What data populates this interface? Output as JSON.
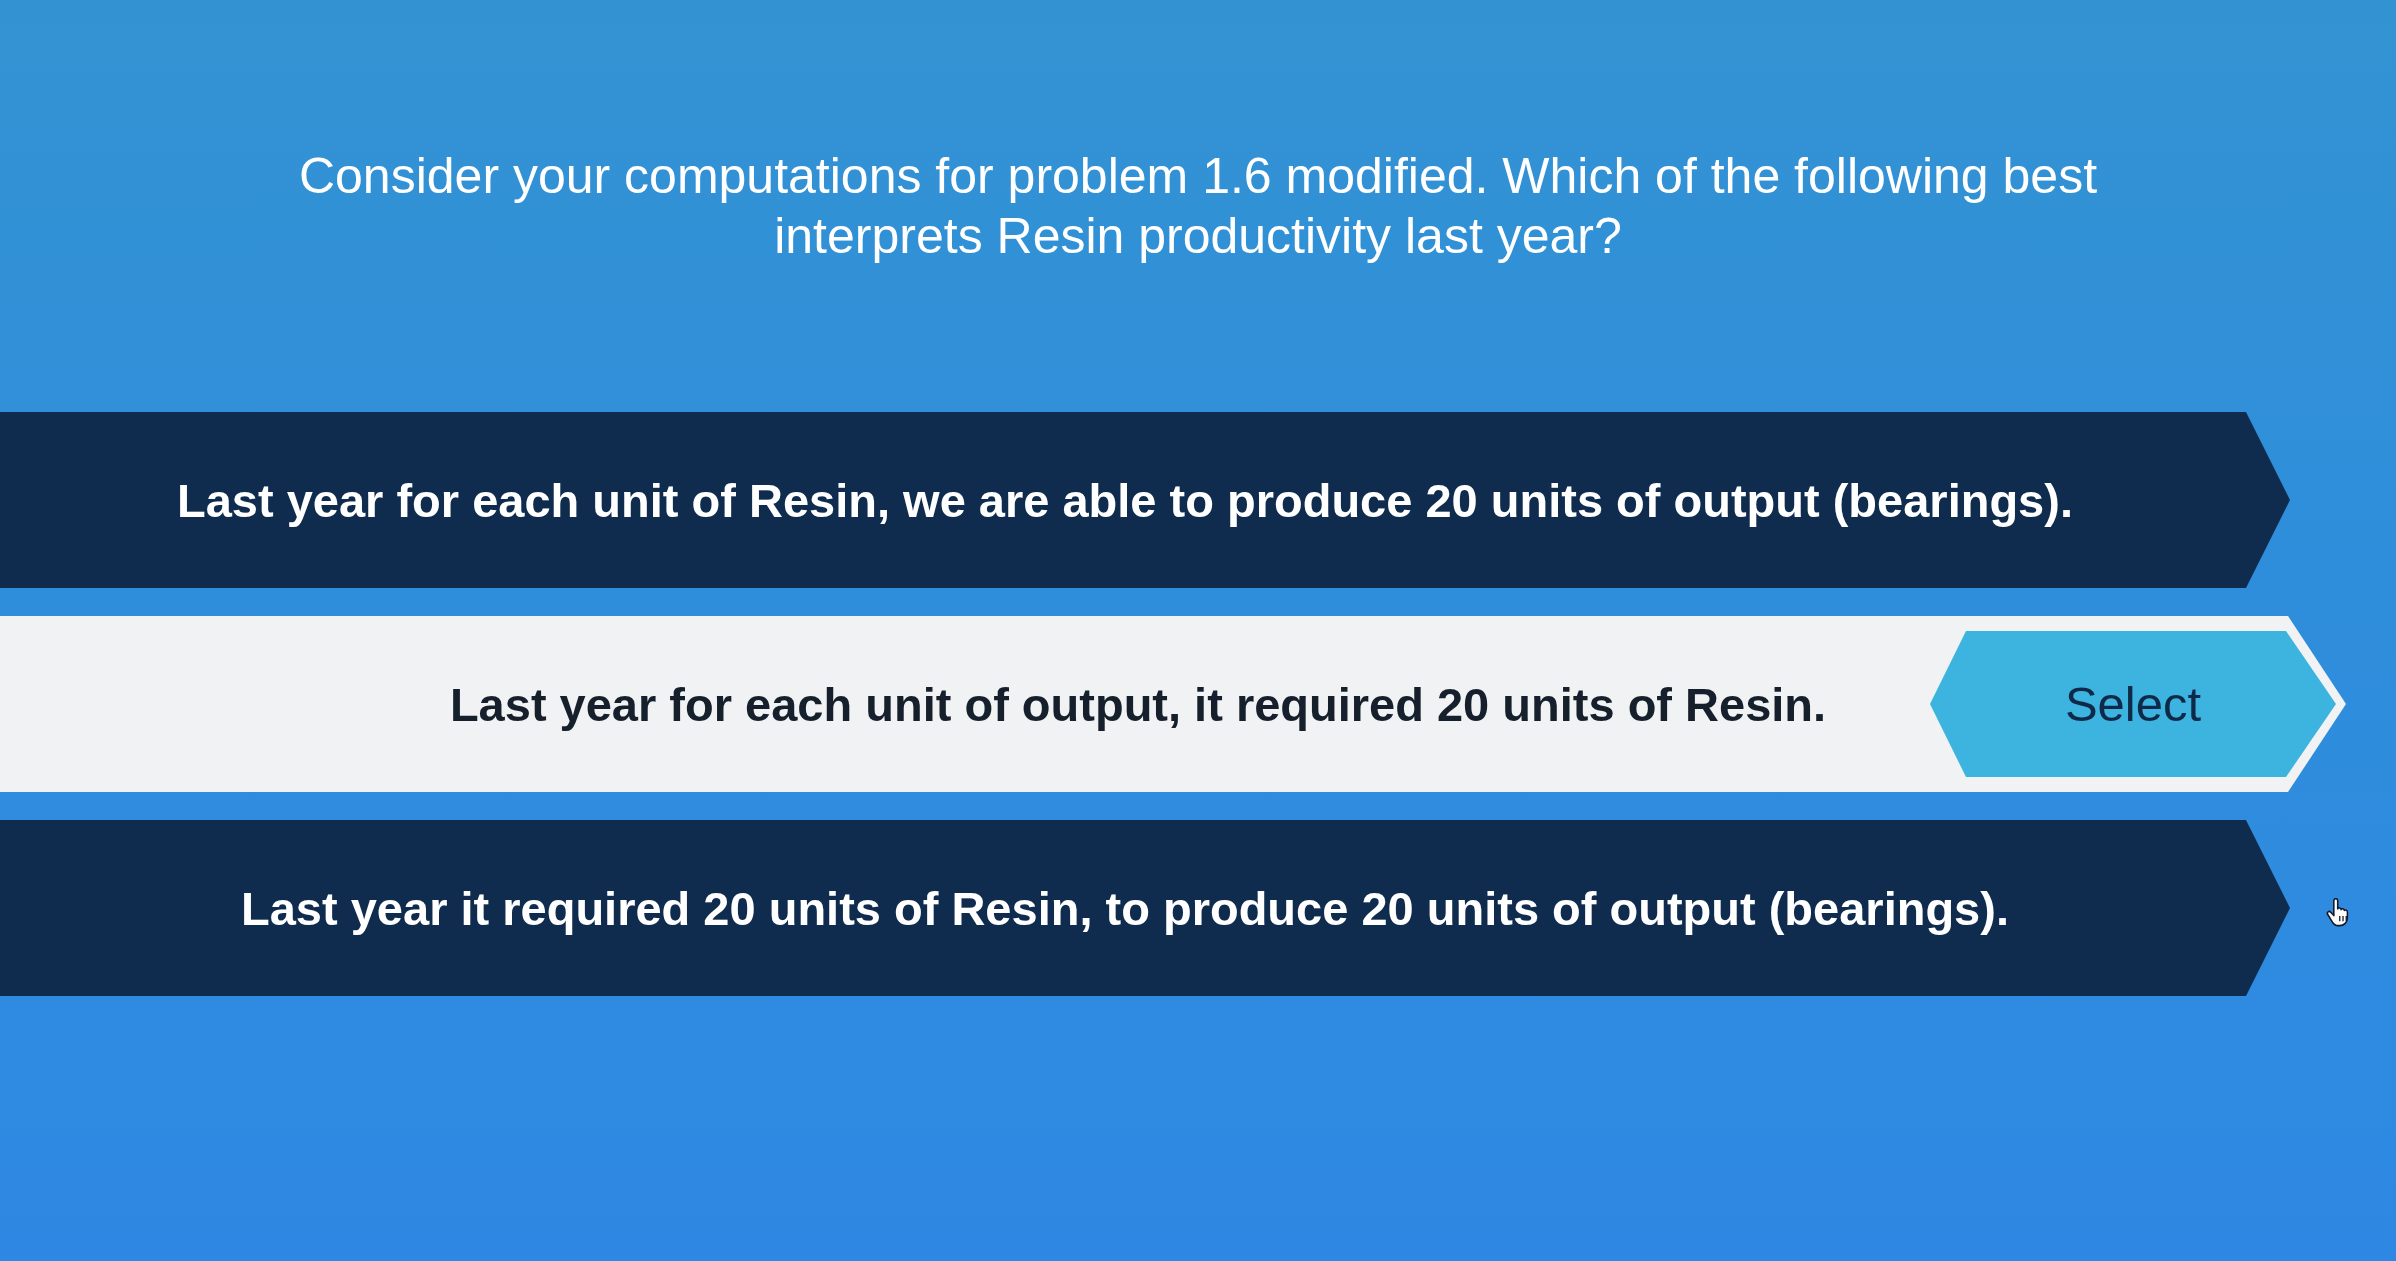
{
  "question": "Consider your computations for problem 1.6 modified. Which of the following best interprets Resin productivity last year?",
  "options": [
    {
      "text": "Last year for each unit of Resin, we are able to produce 20 units of output (bearings).",
      "hovered": false
    },
    {
      "text": "Last year for each unit of output, it required 20 units of Resin.",
      "hovered": true
    },
    {
      "text": "Last year it required 20 units of Resin, to produce 20 units of output (bearings).",
      "hovered": false
    }
  ],
  "select_button": {
    "label": "Select"
  }
}
